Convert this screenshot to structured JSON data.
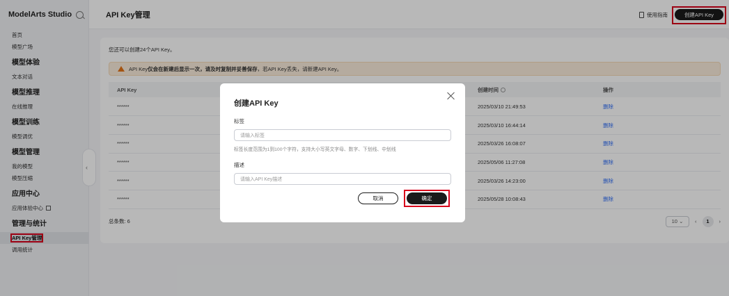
{
  "sidebar": {
    "brand": "ModelArts Studio",
    "home": "首页",
    "model_square": "模型广场",
    "groups": [
      {
        "title": "模型体验",
        "items": [
          "文本对话"
        ]
      },
      {
        "title": "模型推理",
        "items": [
          "在线推理"
        ]
      },
      {
        "title": "模型训练",
        "items": [
          "模型调优"
        ]
      },
      {
        "title": "模型管理",
        "items": [
          "我的模型",
          "模型压缩"
        ]
      },
      {
        "title": "应用中心",
        "items": [
          "应用体验中心"
        ]
      },
      {
        "title": "管理与统计",
        "items": [
          "API Key管理",
          "调用统计"
        ]
      }
    ]
  },
  "header": {
    "title": "API Key管理",
    "guide_label": "使用指南",
    "create_label": "创建API Key"
  },
  "main": {
    "quota_text": "您还可以创建24个API Key。",
    "alert": {
      "prefix": "API Key",
      "bold": "仅会在新建后显示一次，请及时复制并妥善保存",
      "suffix": "，若API Key丢失，请新建API Key。"
    },
    "table": {
      "headers": [
        "API Key",
        "创建时间",
        "操作"
      ],
      "rows": [
        {
          "key": "******",
          "time": "2025/03/10 21:49:53",
          "action": "删除"
        },
        {
          "key": "******",
          "time": "2025/03/10 16:44:14",
          "action": "删除"
        },
        {
          "key": "******",
          "time": "2025/03/26 16:08:07",
          "action": "删除"
        },
        {
          "key": "******",
          "time": "2025/05/06 11:27:08",
          "action": "删除"
        },
        {
          "key": "******",
          "time": "2025/03/26 14:23:00",
          "action": "删除"
        },
        {
          "key": "******",
          "time": "2025/05/28 10:08:43",
          "action": "删除"
        }
      ]
    },
    "total_label": "总条数: 6",
    "page_size": "10",
    "current_page": "1"
  },
  "modal": {
    "title": "创建API Key",
    "tag_label": "标签",
    "tag_placeholder": "请输入标签",
    "tag_hint": "标签长度范围为1到100个字符，支持大小写英文字母、数字、下划线、中划线",
    "desc_label": "描述",
    "desc_placeholder": "请输入API Key描述",
    "cancel_label": "取消",
    "ok_label": "确定"
  },
  "colors": {
    "accent_red": "#d9001b",
    "link_blue": "#2f6df6",
    "warning_orange": "#e37318"
  }
}
